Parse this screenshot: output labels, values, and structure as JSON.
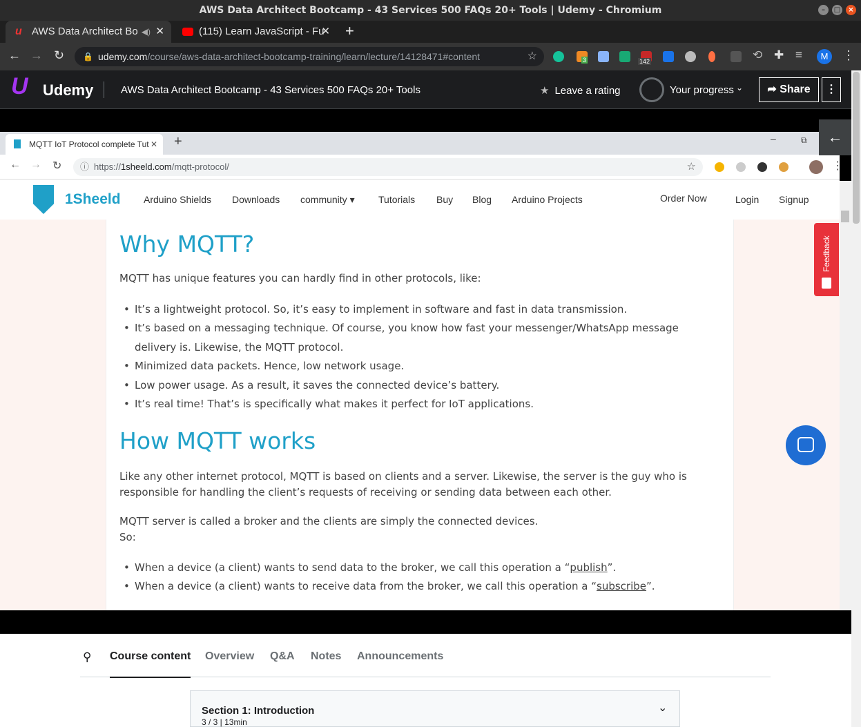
{
  "window": {
    "title": "AWS Data Architect Bootcamp - 43 Services 500 FAQs 20+ Tools | Udemy - Chromium"
  },
  "browser": {
    "tabs": [
      {
        "label": "AWS Data Architect Bo"
      },
      {
        "label": "(115) Learn JavaScript - Fu"
      }
    ],
    "url_host": "udemy.com",
    "url_path": "/course/aws-data-architect-bootcamp-training/learn/lecture/14128471#content",
    "badge_count": "142",
    "badge_small": "3",
    "profile_initial": "M"
  },
  "udemy": {
    "logo": "Udemy",
    "course_title": "AWS Data Architect Bootcamp - 43 Services 500 FAQs 20+ Tools",
    "rate_label": "Leave a rating",
    "progress_label": "Your progress",
    "share_label": "Share",
    "more_label": "⋮"
  },
  "inner_browser": {
    "tab_label": "MQTT IoT Protocol complete Tut",
    "url_prefix": "https://",
    "url_host": "1sheeld.com",
    "url_path": "/mqtt-protocol/"
  },
  "site": {
    "logo": "1Sheeld",
    "nav": [
      "Arduino Shields",
      "Downloads",
      "community ▾",
      "Tutorials",
      "Buy",
      "Blog",
      "Arduino Projects"
    ],
    "order_now": "Order Now",
    "login": "Login",
    "signup": "Signup",
    "feedback": "Feedback"
  },
  "article": {
    "h_why": "Why MQTT?",
    "p_features": "MQTT has unique features you can hardly find in other protocols, like:",
    "features": [
      "It’s a lightweight protocol. So, it’s easy to implement in software and fast in data transmission.",
      "It’s based on a messaging technique. Of course, you know how fast your messenger/WhatsApp message delivery is. Likewise, the MQTT protocol.",
      "Minimized data packets. Hence, low network usage.",
      "Low power usage. As a result, it saves the connected device’s battery.",
      "It’s real time! That’s is specifically what makes it perfect for IoT applications."
    ],
    "h_how": "How MQTT works",
    "p_how": "Like any other internet protocol, MQTT is based on clients and a server. Likewise, the server is the guy who is responsible for handling the client’s requests of receiving or sending data between each other.",
    "p_broker": "MQTT server is called a broker and the clients are simply the connected devices.",
    "p_so": "So:",
    "op1_pre": "When a device (a client) wants to send data to the broker, we call this operation a “",
    "op1_link": "publish",
    "op1_post": "”.",
    "op2_pre": "When a device (a client) wants to receive data from the broker, we call this operation a “",
    "op2_link": "subscribe",
    "op2_post": "”."
  },
  "course_tabs": [
    "Course content",
    "Overview",
    "Q&A",
    "Notes",
    "Announcements"
  ],
  "section": {
    "title": "Section 1: Introduction",
    "meta": "3 / 3 | 13min"
  }
}
